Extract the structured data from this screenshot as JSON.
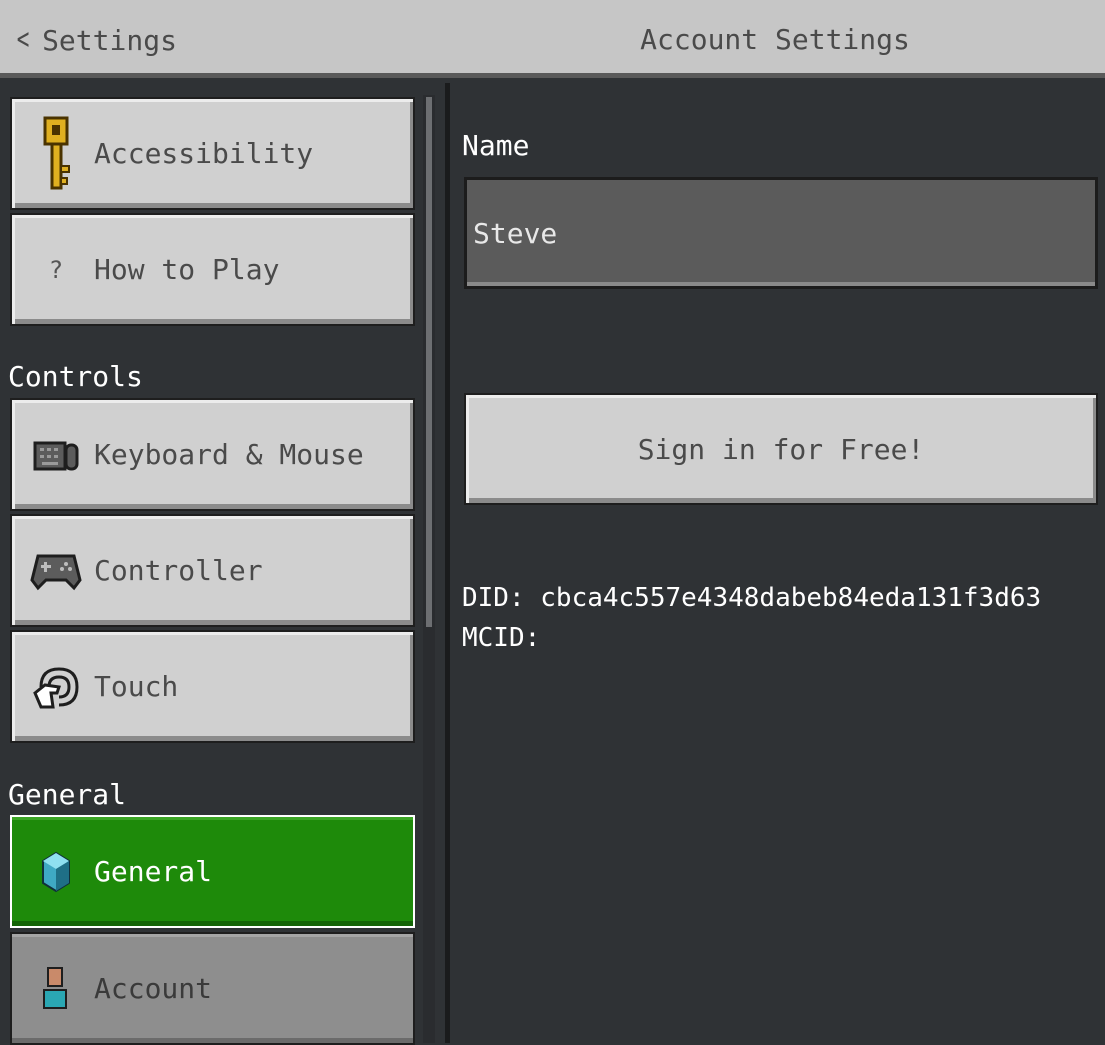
{
  "header": {
    "back_label": "Settings",
    "title": "Account Settings"
  },
  "sidebar": {
    "items_top": [
      {
        "label": "Accessibility",
        "icon": "key-icon"
      },
      {
        "label": "How to Play",
        "icon": "question-icon"
      }
    ],
    "controls_section": "Controls",
    "controls_items": [
      {
        "label": "Keyboard & Mouse",
        "icon": "keyboard-icon"
      },
      {
        "label": "Controller",
        "icon": "controller-icon"
      },
      {
        "label": "Touch",
        "icon": "touch-icon"
      }
    ],
    "general_section": "General",
    "general_items": [
      {
        "label": "General",
        "icon": "cube-icon",
        "active": true
      },
      {
        "label": "Account",
        "icon": "account-icon"
      }
    ]
  },
  "main": {
    "name_label": "Name",
    "name_value": "Steve",
    "signin_label": "Sign in for Free!",
    "did_text": "DID: cbca4c557e4348dabeb84eda131f3d63",
    "mcid_text": "MCID:"
  },
  "colors": {
    "background": "#2f3235",
    "header": "#c6c6c6",
    "button": "#d0d0d0",
    "active": "#1e8a0a",
    "input": "#5b5b5b"
  }
}
